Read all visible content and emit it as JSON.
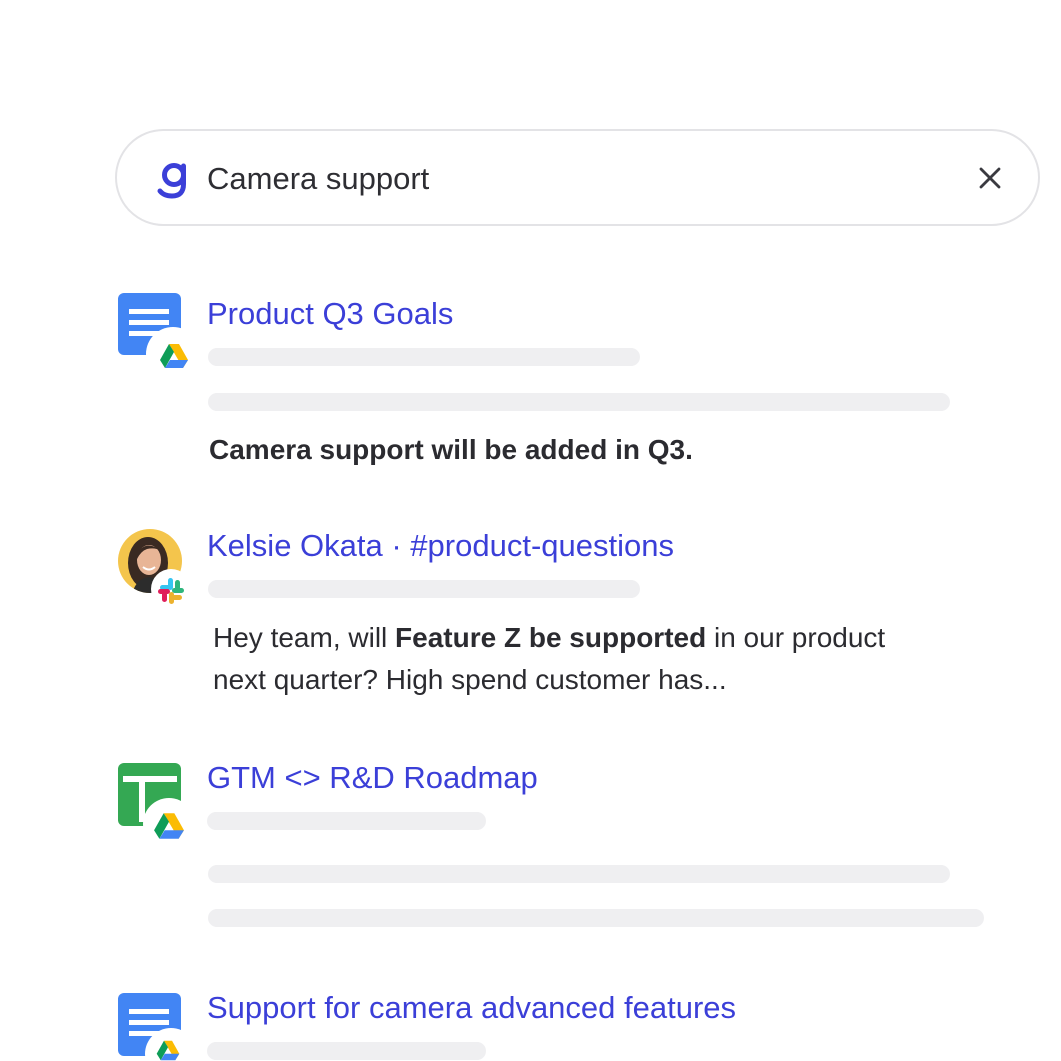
{
  "search": {
    "query": "Camera support",
    "placeholder": ""
  },
  "colors": {
    "accent": "#3b3fd8",
    "docs_blue": "#4285f4",
    "sheets_green": "#34a853",
    "skeleton": "#efeff1"
  },
  "results": [
    {
      "title": "Product Q3 Goals",
      "icon": "google-docs-icon",
      "badge": "google-drive-icon",
      "snippet": "Camera support will be added in Q3."
    },
    {
      "title": "Kelsie Okata · #product-questions",
      "icon": "avatar",
      "badge": "slack-icon",
      "snippet_parts": {
        "pre": "Hey team, will ",
        "bold": "Feature Z be supported",
        "post_line1": " in our product",
        "line2": "next quarter? High spend customer has..."
      }
    },
    {
      "title": "GTM <> R&D Roadmap",
      "icon": "google-sheets-icon",
      "badge": "google-drive-icon"
    },
    {
      "title": "Support for camera advanced features",
      "icon": "google-docs-icon",
      "badge": "google-drive-icon"
    }
  ]
}
